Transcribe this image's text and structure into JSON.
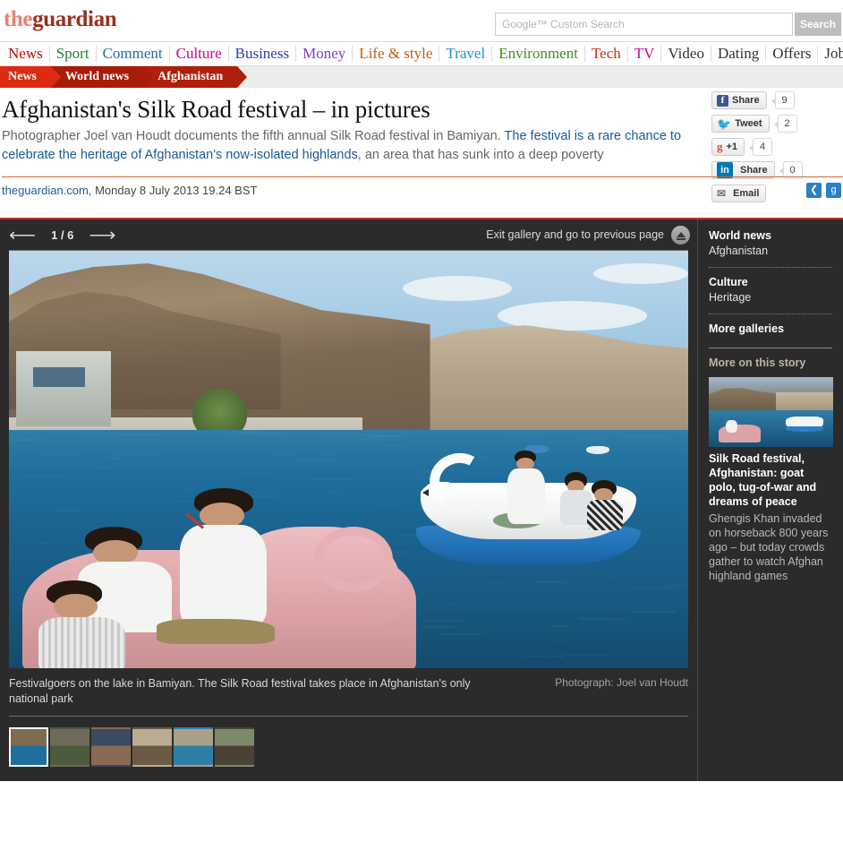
{
  "brand": {
    "the": "the",
    "guardian": "guardian"
  },
  "search": {
    "placeholder": "Google™ Custom Search",
    "value": "",
    "button_label": "Search"
  },
  "topnav": [
    {
      "label": "News",
      "color": "#c70000"
    },
    {
      "label": "Sport",
      "color": "#2a7d2a"
    },
    {
      "label": "Comment",
      "color": "#1f6bb0"
    },
    {
      "label": "Culture",
      "color": "#cc0099"
    },
    {
      "label": "Business",
      "color": "#2a3fb0"
    },
    {
      "label": "Money",
      "color": "#7a3fc4"
    },
    {
      "label": "Life & style",
      "color": "#b9601a"
    },
    {
      "label": "Travel",
      "color": "#1f8fd4"
    },
    {
      "label": "Environment",
      "color": "#3f8f1f"
    },
    {
      "label": "Tech",
      "color": "#cc3311"
    },
    {
      "label": "TV",
      "color": "#cc0099"
    },
    {
      "label": "Video",
      "color": "#333333"
    },
    {
      "label": "Dating",
      "color": "#333333"
    },
    {
      "label": "Offers",
      "color": "#333333"
    },
    {
      "label": "Jobs",
      "color": "#333333"
    }
  ],
  "breadcrumb": [
    {
      "label": "News"
    },
    {
      "label": "World news"
    },
    {
      "label": "Afghanistan"
    }
  ],
  "article": {
    "headline": "Afghanistan's Silk Road festival – in pictures",
    "standfirst_lead": "Photographer Joel van Houdt documents the fifth annual Silk Road festival in Bamiyan. ",
    "standfirst_link": "The festival is a rare chance to celebrate the heritage of Afghanistan's now-isolated highlands",
    "standfirst_tail": ", an area that has sunk into a deep poverty",
    "source": "theguardian.com",
    "date": ", Monday 8 July 2013 19.24 BST"
  },
  "social": [
    {
      "network": "facebook",
      "label": "Share",
      "icon": "facebook-icon",
      "glyph": "f",
      "count": "9"
    },
    {
      "network": "twitter",
      "label": "Tweet",
      "icon": "twitter-icon",
      "glyph": "🐦",
      "count": "2"
    },
    {
      "network": "googleplus",
      "label": "+1",
      "icon": "google-plus-icon",
      "glyph": "g",
      "count": "4"
    },
    {
      "network": "linkedin",
      "label": "Share",
      "icon": "linkedin-icon",
      "glyph": "in",
      "count": "0"
    },
    {
      "network": "email",
      "label": "Email",
      "icon": "envelope-icon",
      "glyph": "✉",
      "count": ""
    }
  ],
  "meta_icons": [
    {
      "name": "share-icon",
      "glyph": "<"
    },
    {
      "name": "guardian-icon",
      "glyph": "g"
    }
  ],
  "gallery": {
    "prev_icon": "arrow-left-icon",
    "next_icon": "arrow-right-icon",
    "counter": "1 / 6",
    "exit_label": "Exit gallery and go to previous page",
    "exit_icon": "eject-icon",
    "caption": "Festivalgoers on the lake in Bamiyan. The Silk Road festival takes place in Afghanistan's only national park",
    "credit": "Photograph: Joel van Houdt",
    "thumbnails": [
      {
        "alt": "Pink swan pedalo on lake",
        "selected": true,
        "c1": "#7d6b52",
        "c2": "#1f6e9c"
      },
      {
        "alt": "Crowd on highland plain",
        "selected": false,
        "c1": "#6f6a5a",
        "c2": "#4c5a3e"
      },
      {
        "alt": "Festival crowd cheering",
        "selected": false,
        "c1": "#3d4a63",
        "c2": "#8a6a52"
      },
      {
        "alt": "Horseman on plain",
        "selected": false,
        "c1": "#b9ac92",
        "c2": "#6a5a46"
      },
      {
        "alt": "Boy wading in lake",
        "selected": false,
        "c1": "#a9a08c",
        "c2": "#2f7ea8"
      },
      {
        "alt": "Audience in hall",
        "selected": false,
        "c1": "#7d8a6a",
        "c2": "#4a4236"
      }
    ]
  },
  "sidebar": {
    "sections": [
      {
        "heading": "World news",
        "sub": "Afghanistan"
      },
      {
        "heading": "Culture",
        "sub": "Heritage"
      }
    ],
    "more_galleries": "More galleries",
    "more_on_story": "More on this story",
    "related": {
      "title": "Silk Road festival, Afghanistan: goat polo, tug-of-war and dreams of peace",
      "trail": "Ghengis Khan invaded on horseback 800 years ago – but today crowds gather to watch Afghan highland games",
      "thumb_alt": "Pedalos on Band-e Amir lake"
    }
  }
}
